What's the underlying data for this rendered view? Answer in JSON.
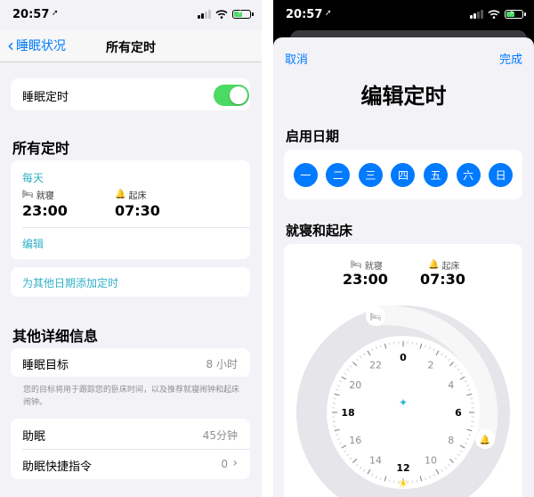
{
  "status": {
    "time": "20:57"
  },
  "left": {
    "nav": {
      "back": "睡眠状况",
      "title": "所有定时"
    },
    "sleep_schedule": {
      "label": "睡眠定时",
      "enabled": true
    },
    "all_schedules": {
      "heading": "所有定时",
      "schedule": {
        "repeat": "每天",
        "bedtime_label": "就寝",
        "bedtime": "23:00",
        "wake_label": "起床",
        "wake": "07:30",
        "edit": "编辑"
      },
      "add_other": "为其他日期添加定时"
    },
    "other_details": {
      "heading": "其他详细信息",
      "goal": {
        "label": "睡眠目标",
        "value": "8 小时"
      },
      "footnote": "您的目标将用于跟踪您的卧床时间，以及推荐就寝闹钟和起床闹钟。",
      "wind_down": {
        "label": "助眠",
        "value": "45分钟"
      },
      "shortcuts": {
        "label": "助眠快捷指令",
        "value": "0"
      }
    }
  },
  "right": {
    "cancel": "取消",
    "done": "完成",
    "title": "编辑定时",
    "days_heading": "启用日期",
    "days": [
      "一",
      "二",
      "三",
      "四",
      "五",
      "六",
      "日"
    ],
    "clock_heading": "就寝和起床",
    "bedtime_label": "就寝",
    "bedtime": "23:00",
    "wake_label": "起床",
    "wake": "07:30",
    "clock_numbers": [
      "0",
      "2",
      "4",
      "6",
      "8",
      "10",
      "12",
      "14",
      "16",
      "18",
      "20",
      "22"
    ]
  },
  "colors": {
    "accent": "#007aff",
    "toggle_on": "#4cd964",
    "teal": "#30b0c7",
    "sparkle": "#2fb5d1",
    "sun": "#ffcc00"
  },
  "icons": [
    "location-arrow-icon",
    "signal-icon",
    "wifi-icon",
    "battery-icon",
    "bed-icon",
    "bell-icon",
    "chevron-left-icon",
    "chevron-right-icon",
    "sparkle-icon",
    "sun-icon"
  ]
}
